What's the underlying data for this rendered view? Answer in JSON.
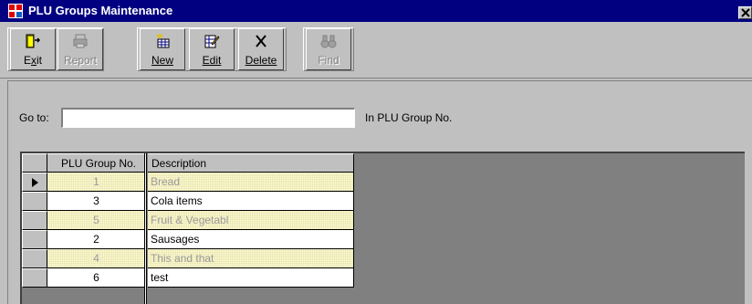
{
  "window": {
    "title": "PLU Groups Maintenance",
    "close_glyph": "✕",
    "icon": "plu-app-icon",
    "title_bar_color": "#000080"
  },
  "toolbar": {
    "buttons": [
      {
        "label": "Exit",
        "mnemonic_index": 1,
        "icon": "exit-door-icon",
        "enabled": true
      },
      {
        "label": "Report",
        "mnemonic_index": 0,
        "icon": "printer-icon",
        "enabled": false
      },
      {
        "label": "New",
        "mnemonic_index": 0,
        "icon": "new-record-icon",
        "enabled": true
      },
      {
        "label": "Edit",
        "mnemonic_index": 0,
        "icon": "edit-record-icon",
        "enabled": true
      },
      {
        "label": "Delete",
        "mnemonic_index": 0,
        "icon": "delete-x-icon",
        "enabled": true
      },
      {
        "label": "Find",
        "mnemonic_index": 0,
        "icon": "binoculars-icon",
        "enabled": false
      }
    ]
  },
  "goto": {
    "label": "Go to:",
    "value": "",
    "suffix": "In PLU Group No."
  },
  "grid": {
    "columns": [
      "PLU Group No.",
      "Description"
    ],
    "current_row": 0,
    "rows": [
      {
        "no": "1",
        "description": "Bread",
        "alt": true
      },
      {
        "no": "3",
        "description": "Cola items",
        "alt": false
      },
      {
        "no": "5",
        "description": "Fruit & Vegetabl",
        "alt": true
      },
      {
        "no": "2",
        "description": "Sausages",
        "alt": false
      },
      {
        "no": "4",
        "description": "This and that",
        "alt": true
      },
      {
        "no": "6",
        "description": "test",
        "alt": false
      }
    ],
    "alt_row_color": "#fffbd8"
  }
}
